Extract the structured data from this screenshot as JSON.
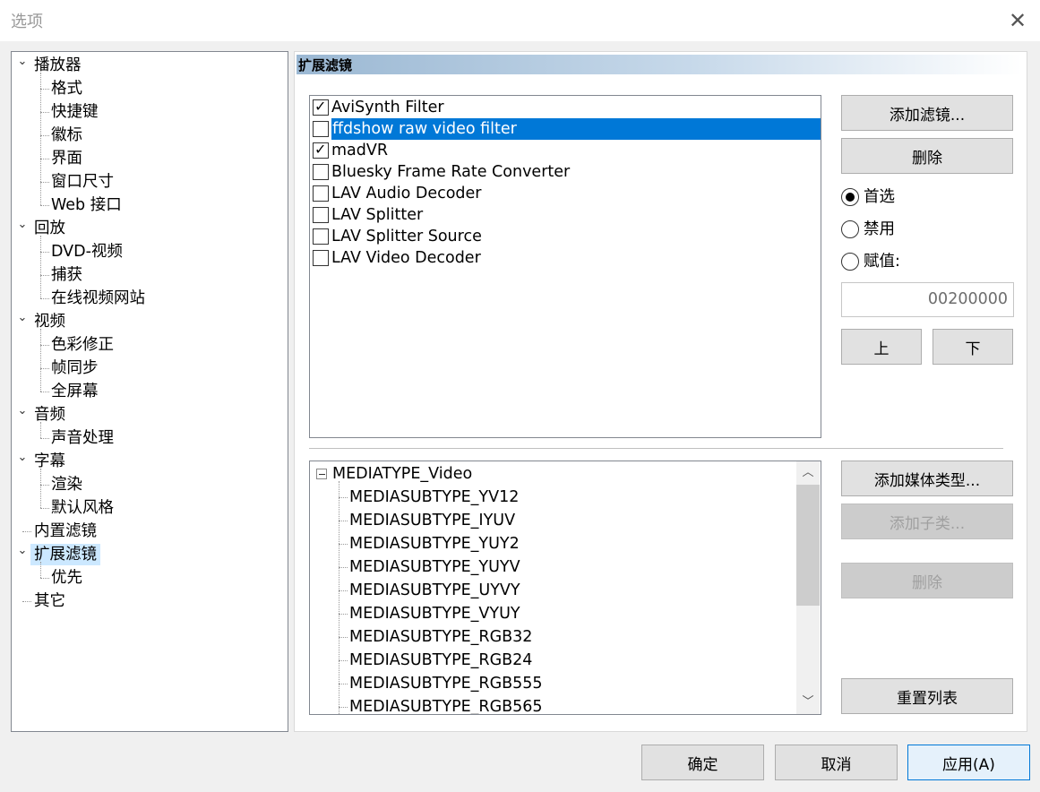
{
  "window": {
    "title": "选项",
    "close_icon": "close-icon"
  },
  "tree": {
    "items": [
      {
        "label": "播放器",
        "level": 0,
        "expanded": true
      },
      {
        "label": "格式",
        "level": 1
      },
      {
        "label": "快捷键",
        "level": 1
      },
      {
        "label": "徽标",
        "level": 1
      },
      {
        "label": "界面",
        "level": 1
      },
      {
        "label": "窗口尺寸",
        "level": 1
      },
      {
        "label": "Web 接口",
        "level": 1
      },
      {
        "label": "回放",
        "level": 0,
        "expanded": true
      },
      {
        "label": "DVD-视频",
        "level": 1
      },
      {
        "label": "捕获",
        "level": 1
      },
      {
        "label": "在线视频网站",
        "level": 1
      },
      {
        "label": "视频",
        "level": 0,
        "expanded": true
      },
      {
        "label": "色彩修正",
        "level": 1
      },
      {
        "label": "帧同步",
        "level": 1
      },
      {
        "label": "全屏幕",
        "level": 1
      },
      {
        "label": "音频",
        "level": 0,
        "expanded": true
      },
      {
        "label": "声音处理",
        "level": 1
      },
      {
        "label": "字幕",
        "level": 0,
        "expanded": true
      },
      {
        "label": "渲染",
        "level": 1
      },
      {
        "label": "默认风格",
        "level": 1
      },
      {
        "label": "内置滤镜",
        "level": 0,
        "expanded": false
      },
      {
        "label": "扩展滤镜",
        "level": 0,
        "expanded": true,
        "selected": true
      },
      {
        "label": "优先",
        "level": 1
      },
      {
        "label": "其它",
        "level": 0,
        "expanded": false
      }
    ]
  },
  "section": {
    "title": "扩展滤镜"
  },
  "filters": [
    {
      "label": "AviSynth Filter",
      "checked": true
    },
    {
      "label": "ffdshow raw video filter",
      "checked": false,
      "selected": true
    },
    {
      "label": "madVR",
      "checked": true
    },
    {
      "label": "Bluesky Frame Rate Converter",
      "checked": false
    },
    {
      "label": "LAV Audio Decoder",
      "checked": false
    },
    {
      "label": "LAV Splitter",
      "checked": false
    },
    {
      "label": "LAV Splitter Source",
      "checked": false
    },
    {
      "label": "LAV Video Decoder",
      "checked": false
    }
  ],
  "filter_buttons": {
    "add": "添加滤镜...",
    "remove": "删除",
    "up": "上",
    "down": "下"
  },
  "merit": {
    "options": [
      {
        "label": "首选",
        "checked": true
      },
      {
        "label": "禁用",
        "checked": false
      },
      {
        "label": "赋值:",
        "checked": false
      }
    ],
    "value": "00200000"
  },
  "media": {
    "root": "MEDIATYPE_Video",
    "collapse_icon": "minus-box-icon",
    "subtypes": [
      "MEDIASUBTYPE_YV12",
      "MEDIASUBTYPE_IYUV",
      "MEDIASUBTYPE_YUY2",
      "MEDIASUBTYPE_YUYV",
      "MEDIASUBTYPE_UYVY",
      "MEDIASUBTYPE_VYUY",
      "MEDIASUBTYPE_RGB32",
      "MEDIASUBTYPE_RGB24",
      "MEDIASUBTYPE_RGB555",
      "MEDIASUBTYPE_RGB565"
    ]
  },
  "media_buttons": {
    "add_type": "添加媒体类型...",
    "add_subtype": "添加子类...",
    "remove": "删除",
    "reset": "重置列表"
  },
  "footer": {
    "ok": "确定",
    "cancel": "取消",
    "apply": "应用(A)"
  },
  "colors": {
    "selection": "#0078d7",
    "tree_selection": "#cce8ff",
    "header_gradient_start": "#9bb8d3"
  }
}
